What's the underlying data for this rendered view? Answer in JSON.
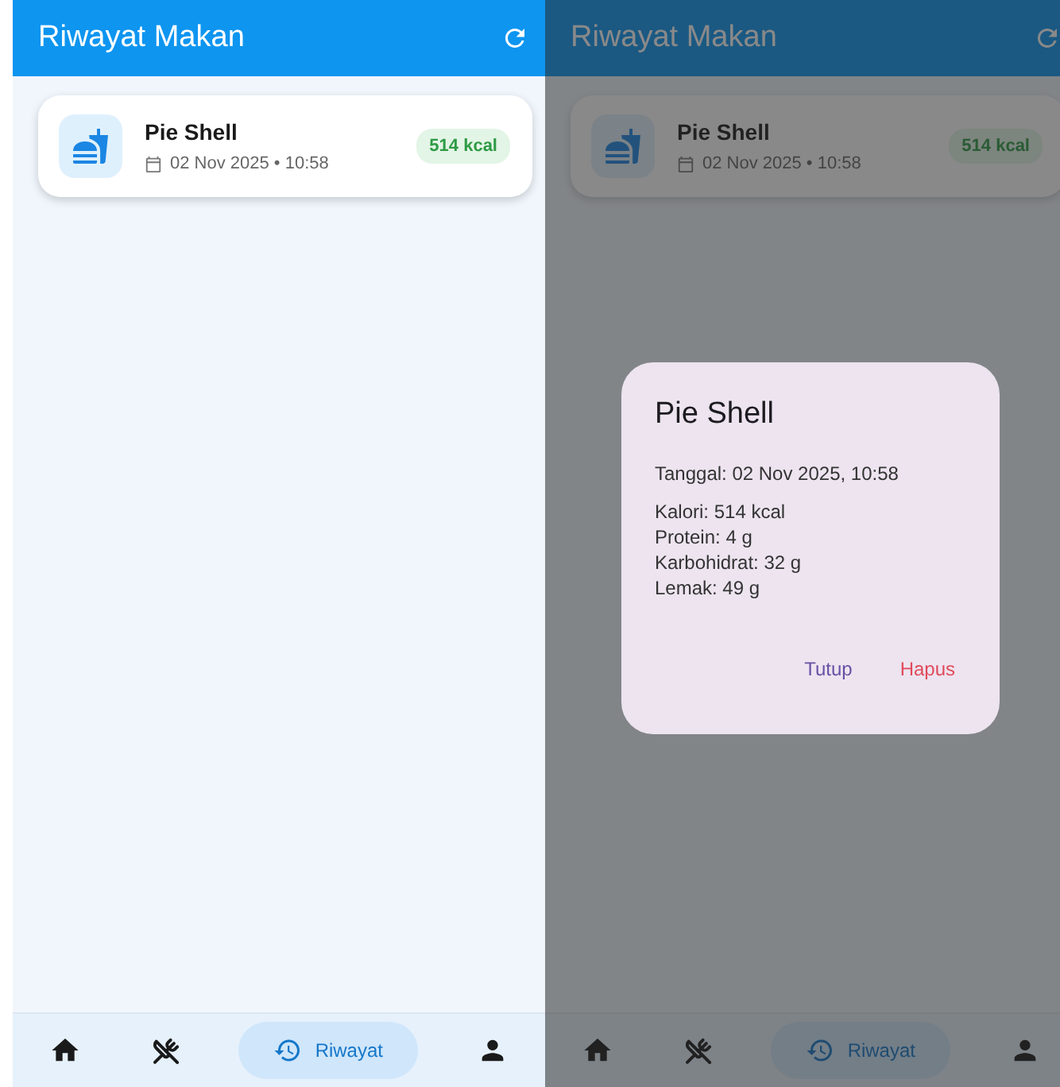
{
  "screens": [
    {
      "title": "Riwayat Makan",
      "dimmed": false,
      "entries": [
        {
          "name": "Pie Shell",
          "date": "02 Nov 2025 • 10:58",
          "calories": "514 kcal"
        }
      ],
      "nav": [
        {
          "kind": "home",
          "selected": false
        },
        {
          "kind": "food",
          "selected": false
        },
        {
          "kind": "history",
          "label": "Riwayat",
          "selected": true
        },
        {
          "kind": "profile",
          "selected": false
        }
      ]
    },
    {
      "title": "Riwayat Makan",
      "dimmed": true,
      "entries": [
        {
          "name": "Pie Shell",
          "date": "02 Nov 2025 • 10:58",
          "calories": "514 kcal"
        }
      ],
      "nav": [
        {
          "kind": "home",
          "selected": false
        },
        {
          "kind": "food",
          "selected": false
        },
        {
          "kind": "history",
          "label": "Riwayat",
          "selected": true
        },
        {
          "kind": "profile",
          "selected": false
        }
      ],
      "dialog": {
        "title": "Pie Shell",
        "date": "Tanggal: 02 Nov 2025, 10:58",
        "lines": [
          "Kalori: 514 kcal",
          "Protein: 4 g",
          "Karbohidrat: 32 g",
          "Lemak: 49 g"
        ],
        "actions": [
          {
            "label": "Tutup",
            "kind": "neutral"
          },
          {
            "label": "Hapus",
            "kind": "danger"
          }
        ]
      }
    }
  ]
}
